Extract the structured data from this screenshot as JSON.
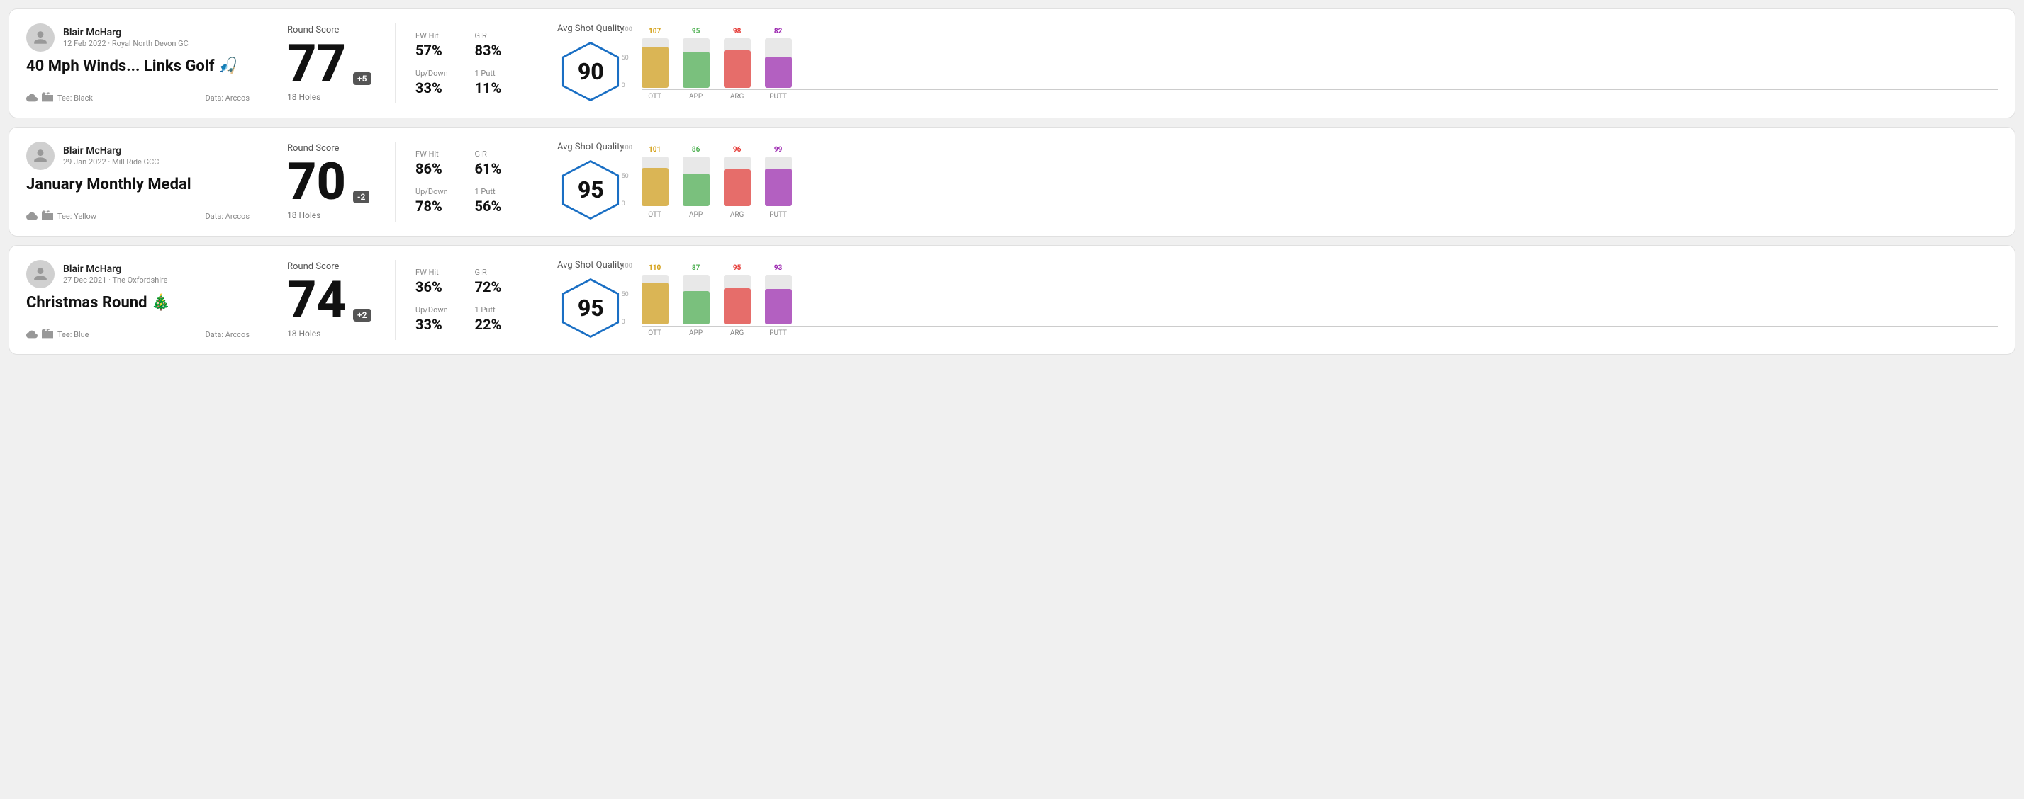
{
  "rounds": [
    {
      "id": "round1",
      "player_name": "Blair McHarg",
      "player_meta": "12 Feb 2022 · Royal North Devon GC",
      "round_title": "40 Mph Winds... Links Golf 🎣",
      "tee": "Tee: Black",
      "data_source": "Data: Arccos",
      "round_score_label": "Round Score",
      "score": "77",
      "score_badge": "+5",
      "holes": "18 Holes",
      "fw_hit_label": "FW Hit",
      "fw_hit": "57%",
      "gir_label": "GIR",
      "gir": "83%",
      "updown_label": "Up/Down",
      "updown": "33%",
      "oneputt_label": "1 Putt",
      "oneputt": "11%",
      "avg_quality_label": "Avg Shot Quality",
      "quality_score": "90",
      "chart": {
        "bars": [
          {
            "label": "OTT",
            "value": 107,
            "color_class": "bg-ott",
            "label_color": "color-ott"
          },
          {
            "label": "APP",
            "value": 95,
            "color_class": "bg-app",
            "label_color": "color-app"
          },
          {
            "label": "ARG",
            "value": 98,
            "color_class": "bg-arg",
            "label_color": "color-arg"
          },
          {
            "label": "PUTT",
            "value": 82,
            "color_class": "bg-putt",
            "label_color": "color-putt"
          }
        ]
      }
    },
    {
      "id": "round2",
      "player_name": "Blair McHarg",
      "player_meta": "29 Jan 2022 · Mill Ride GCC",
      "round_title": "January Monthly Medal",
      "tee": "Tee: Yellow",
      "data_source": "Data: Arccos",
      "round_score_label": "Round Score",
      "score": "70",
      "score_badge": "-2",
      "holes": "18 Holes",
      "fw_hit_label": "FW Hit",
      "fw_hit": "86%",
      "gir_label": "GIR",
      "gir": "61%",
      "updown_label": "Up/Down",
      "updown": "78%",
      "oneputt_label": "1 Putt",
      "oneputt": "56%",
      "avg_quality_label": "Avg Shot Quality",
      "quality_score": "95",
      "chart": {
        "bars": [
          {
            "label": "OTT",
            "value": 101,
            "color_class": "bg-ott",
            "label_color": "color-ott"
          },
          {
            "label": "APP",
            "value": 86,
            "color_class": "bg-app",
            "label_color": "color-app"
          },
          {
            "label": "ARG",
            "value": 96,
            "color_class": "bg-arg",
            "label_color": "color-arg"
          },
          {
            "label": "PUTT",
            "value": 99,
            "color_class": "bg-putt",
            "label_color": "color-putt"
          }
        ]
      }
    },
    {
      "id": "round3",
      "player_name": "Blair McHarg",
      "player_meta": "27 Dec 2021 · The Oxfordshire",
      "round_title": "Christmas Round 🎄",
      "tee": "Tee: Blue",
      "data_source": "Data: Arccos",
      "round_score_label": "Round Score",
      "score": "74",
      "score_badge": "+2",
      "holes": "18 Holes",
      "fw_hit_label": "FW Hit",
      "fw_hit": "36%",
      "gir_label": "GIR",
      "gir": "72%",
      "updown_label": "Up/Down",
      "updown": "33%",
      "oneputt_label": "1 Putt",
      "oneputt": "22%",
      "avg_quality_label": "Avg Shot Quality",
      "quality_score": "95",
      "chart": {
        "bars": [
          {
            "label": "OTT",
            "value": 110,
            "color_class": "bg-ott",
            "label_color": "color-ott"
          },
          {
            "label": "APP",
            "value": 87,
            "color_class": "bg-app",
            "label_color": "color-app"
          },
          {
            "label": "ARG",
            "value": 95,
            "color_class": "bg-arg",
            "label_color": "color-arg"
          },
          {
            "label": "PUTT",
            "value": 93,
            "color_class": "bg-putt",
            "label_color": "color-putt"
          }
        ]
      }
    }
  ],
  "y_labels": [
    "100",
    "50",
    "0"
  ]
}
